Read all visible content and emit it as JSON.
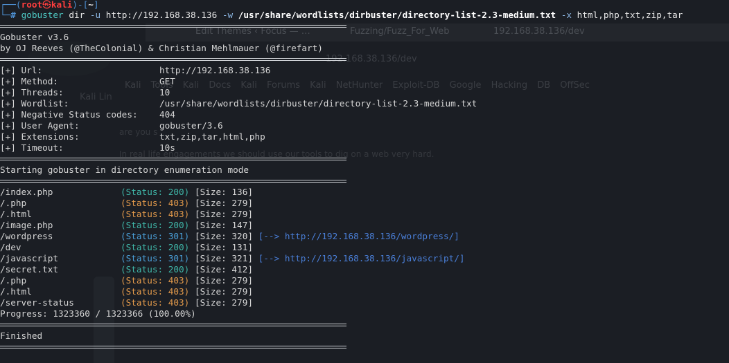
{
  "background": {
    "tabs": [
      "Edit Themes ‹ Focus — …",
      "Fuzzing/Fuzz_For_Web",
      "192.168.38.136/dev"
    ],
    "url": "192.168.38.136/dev",
    "bookmarks": "Kali Tools   Kali Docs   Kali Forums   Kali NetHunter   Exploit-DB   Google Hacking DB   OffSec",
    "side_label": "Kali Lin",
    "text1": "are you s",
    "text2": "In real life engagements we should use our tools to dig on a web very hard."
  },
  "prompt": {
    "top_prefix": "┌──(",
    "user": "root",
    "at": "㉿",
    "host": "kali",
    "mid": ")-[",
    "dir": "~",
    "end": "]",
    "bottom_prefix": "└─",
    "hash": "#"
  },
  "command": {
    "bin": "gobuster",
    "sub": "dir",
    "flag_u": "-u",
    "url": "http://192.168.38.136",
    "flag_w": "-w",
    "wordlist": "/usr/share/wordlists/dirbuster/directory-list-2.3-medium.txt",
    "flag_x": "-x",
    "ext": "html,php,txt,zip,tar"
  },
  "banner": {
    "version": "Gobuster v3.6",
    "authors": "by OJ Reeves (@TheColonial) & Christian Mehlmauer (@firefart)"
  },
  "config": [
    {
      "key": "[+] Url:",
      "value": "http://192.168.38.136"
    },
    {
      "key": "[+] Method:",
      "value": "GET"
    },
    {
      "key": "[+] Threads:",
      "value": "10"
    },
    {
      "key": "[+] Wordlist:",
      "value": "/usr/share/wordlists/dirbuster/directory-list-2.3-medium.txt"
    },
    {
      "key": "[+] Negative Status codes:",
      "value": "404"
    },
    {
      "key": "[+] User Agent:",
      "value": "gobuster/3.6"
    },
    {
      "key": "[+] Extensions:",
      "value": "txt,zip,tar,html,php"
    },
    {
      "key": "[+] Timeout:",
      "value": "10s"
    }
  ],
  "start_msg": "Starting gobuster in directory enumeration mode",
  "results": [
    {
      "path": "/index.php",
      "status": "(Status: 200)",
      "size": "[Size: 136]",
      "redirect": "",
      "color": "#3fb6a8"
    },
    {
      "path": "/.php",
      "status": "(Status: 403)",
      "size": "[Size: 279]",
      "redirect": "",
      "color": "#e39a4b"
    },
    {
      "path": "/.html",
      "status": "(Status: 403)",
      "size": "[Size: 279]",
      "redirect": "",
      "color": "#e39a4b"
    },
    {
      "path": "/image.php",
      "status": "(Status: 200)",
      "size": "[Size: 147]",
      "redirect": "",
      "color": "#3fb6a8"
    },
    {
      "path": "/wordpress",
      "status": "(Status: 301)",
      "size": "[Size: 320]",
      "redirect": "[--> http://192.168.38.136/wordpress/]",
      "color": "#4a9fd8"
    },
    {
      "path": "/dev",
      "status": "(Status: 200)",
      "size": "[Size: 131]",
      "redirect": "",
      "color": "#3fb6a8"
    },
    {
      "path": "/javascript",
      "status": "(Status: 301)",
      "size": "[Size: 321]",
      "redirect": "[--> http://192.168.38.136/javascript/]",
      "color": "#4a9fd8"
    },
    {
      "path": "/secret.txt",
      "status": "(Status: 200)",
      "size": "[Size: 412]",
      "redirect": "",
      "color": "#3fb6a8"
    },
    {
      "path": "/.php",
      "status": "(Status: 403)",
      "size": "[Size: 279]",
      "redirect": "",
      "color": "#e39a4b"
    },
    {
      "path": "/.html",
      "status": "(Status: 403)",
      "size": "[Size: 279]",
      "redirect": "",
      "color": "#e39a4b"
    },
    {
      "path": "/server-status",
      "status": "(Status: 403)",
      "size": "[Size: 279]",
      "redirect": "",
      "color": "#e39a4b"
    }
  ],
  "progress": "Progress: 1323360 / 1323366 (100.00%)",
  "finished": "Finished"
}
